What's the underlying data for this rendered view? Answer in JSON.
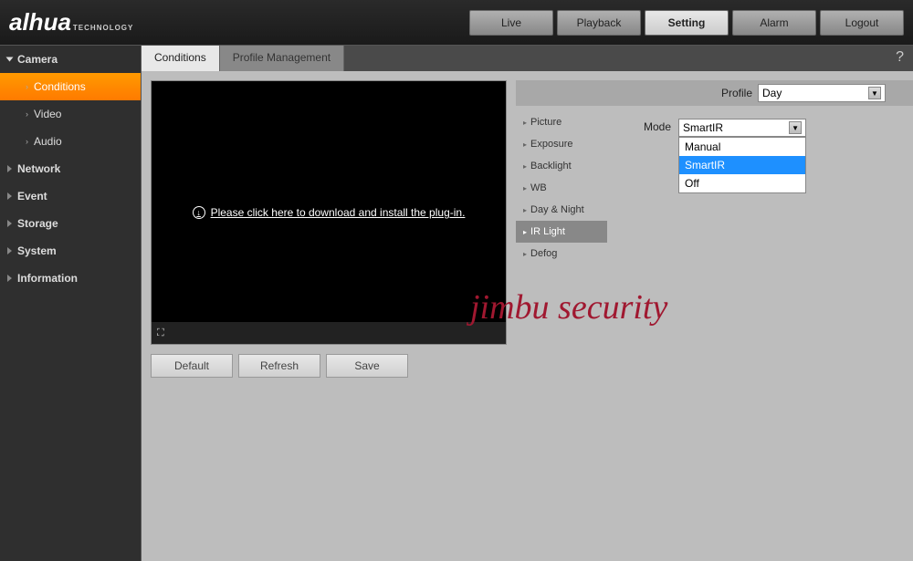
{
  "brand": {
    "name": "alhua",
    "sub": "TECHNOLOGY"
  },
  "nav": {
    "live": "Live",
    "playback": "Playback",
    "setting": "Setting",
    "alarm": "Alarm",
    "logout": "Logout"
  },
  "sidebar": {
    "camera": "Camera",
    "conditions": "Conditions",
    "video": "Video",
    "audio": "Audio",
    "network": "Network",
    "event": "Event",
    "storage": "Storage",
    "system": "System",
    "information": "Information"
  },
  "tabs": {
    "conditions": "Conditions",
    "profile_mgmt": "Profile Management"
  },
  "video": {
    "plugin_text": "Please click here to download and install the plug-in."
  },
  "buttons": {
    "default": "Default",
    "refresh": "Refresh",
    "save": "Save"
  },
  "settings": {
    "profile_label": "Profile",
    "profile_value": "Day",
    "nav": {
      "picture": "Picture",
      "exposure": "Exposure",
      "backlight": "Backlight",
      "wb": "WB",
      "daynight": "Day & Night",
      "irlight": "IR Light",
      "defog": "Defog"
    },
    "mode_label": "Mode",
    "mode_value": "SmartIR",
    "mode_options": {
      "manual": "Manual",
      "smartir": "SmartIR",
      "off": "Off"
    }
  },
  "watermark": "jimbu security"
}
